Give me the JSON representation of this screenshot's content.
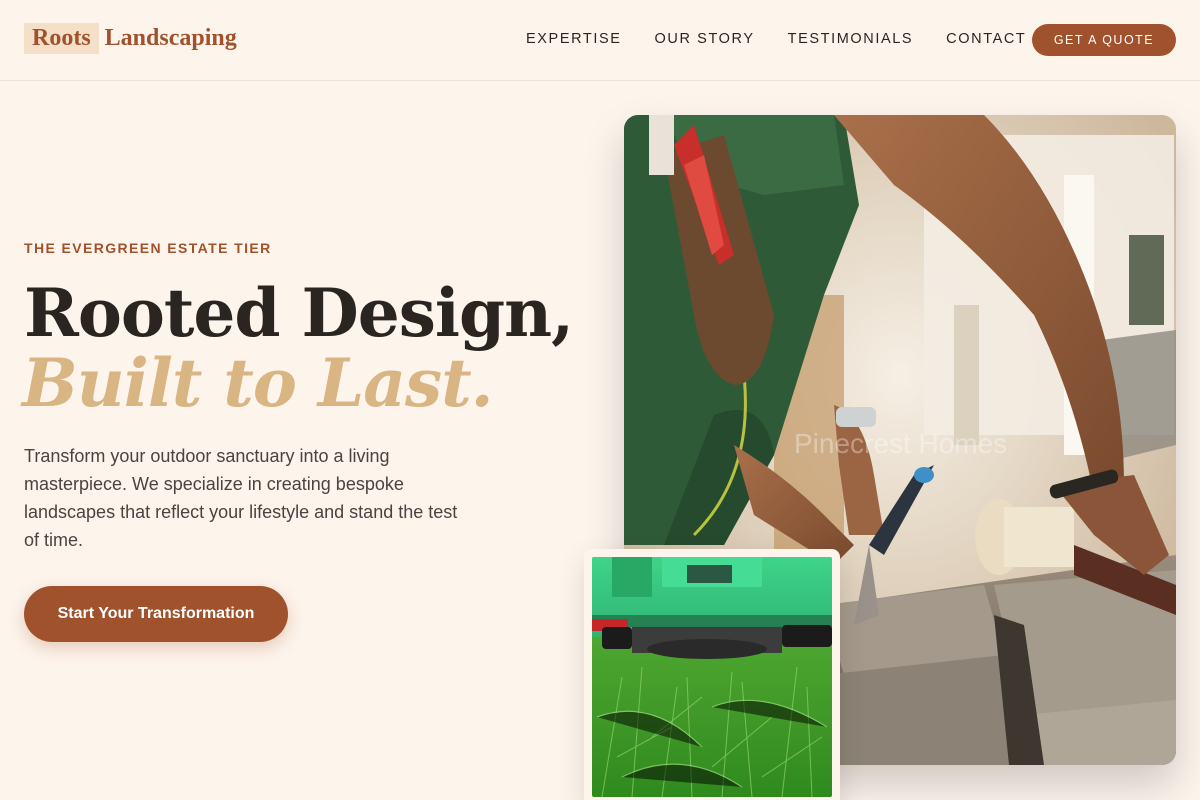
{
  "brand": {
    "part1": "Roots",
    "part2": "Landscaping",
    "color": "#a0522d"
  },
  "nav": {
    "items": [
      {
        "label": "EXPERTISE"
      },
      {
        "label": "OUR STORY"
      },
      {
        "label": "TESTIMONIALS"
      },
      {
        "label": "CONTACT"
      }
    ],
    "cta_label": "GET A QUOTE"
  },
  "hero": {
    "eyebrow": "THE EVERGREEN ESTATE TIER",
    "headline_line1": "Rooted Design,",
    "headline_line2": "Built to Last.",
    "description": "Transform your outdoor sanctuary into a living masterpiece. We specialize in creating bespoke landscapes that reflect your lifestyle and stand the test of time.",
    "cta_label": "Start Your Transformation"
  },
  "colors": {
    "background": "#fdf4ec",
    "accent": "#a0522d",
    "headline_italic": "#d9b584"
  },
  "images": {
    "main_photo": "worker-laying-stone-pavers-photo",
    "secondary_photo": "lawn-mower-on-grass-photo"
  }
}
